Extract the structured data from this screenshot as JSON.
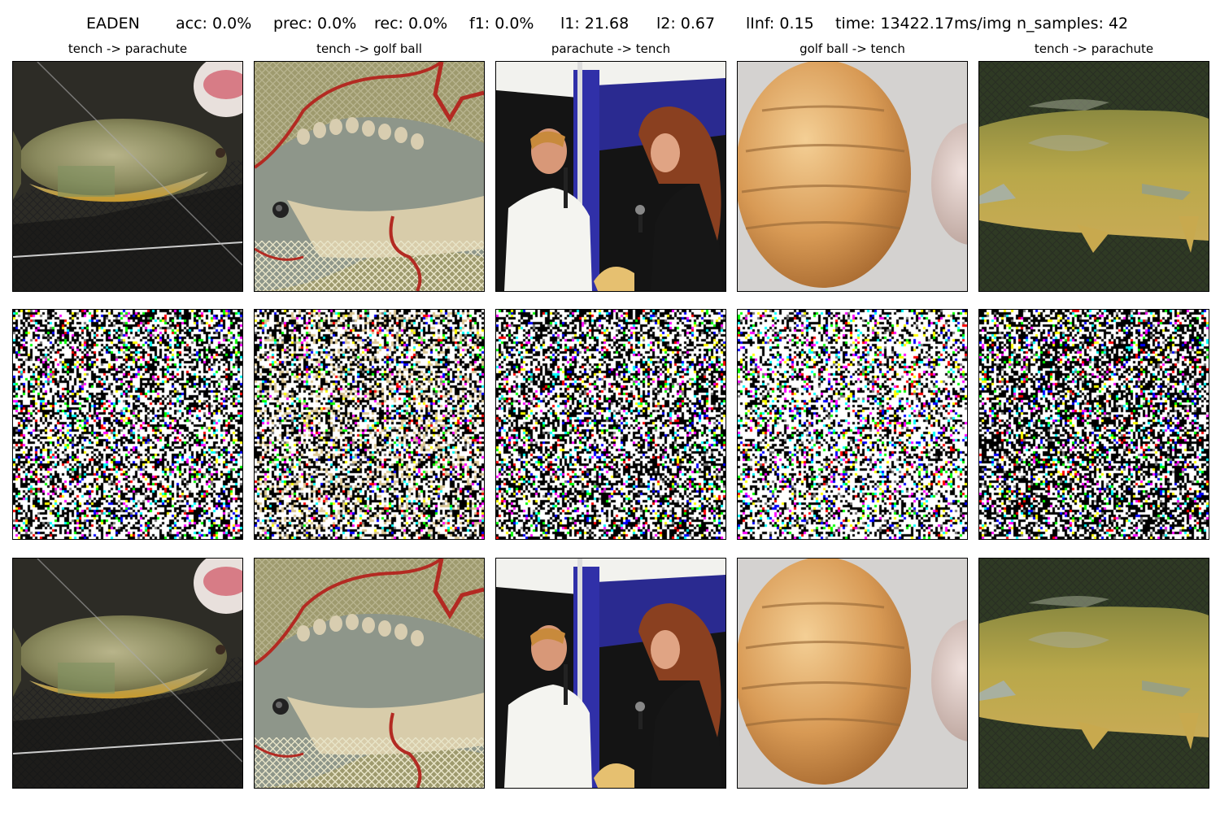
{
  "header": {
    "method": "EADEN",
    "acc": "acc: 0.0%",
    "prec": "prec: 0.0%",
    "rec": "rec: 0.0%",
    "f1": "f1: 0.0%",
    "l1": "l1: 21.68",
    "l2": "l2: 0.67",
    "linf": "lInf: 0.15",
    "time": "time: 13422.17ms/img",
    "n_samples": "n_samples: 42"
  },
  "columns": [
    {
      "title": "tench -> parachute",
      "scene": "tench-in-net"
    },
    {
      "title": "tench -> golf ball",
      "scene": "tench-with-red-line"
    },
    {
      "title": "parachute -> tench",
      "scene": "people-with-microphones"
    },
    {
      "title": "golf ball -> tench",
      "scene": "golf-balls"
    },
    {
      "title": "tench -> parachute",
      "scene": "tench-on-grass"
    }
  ],
  "rows": [
    "original",
    "perturbation",
    "adversarial"
  ]
}
